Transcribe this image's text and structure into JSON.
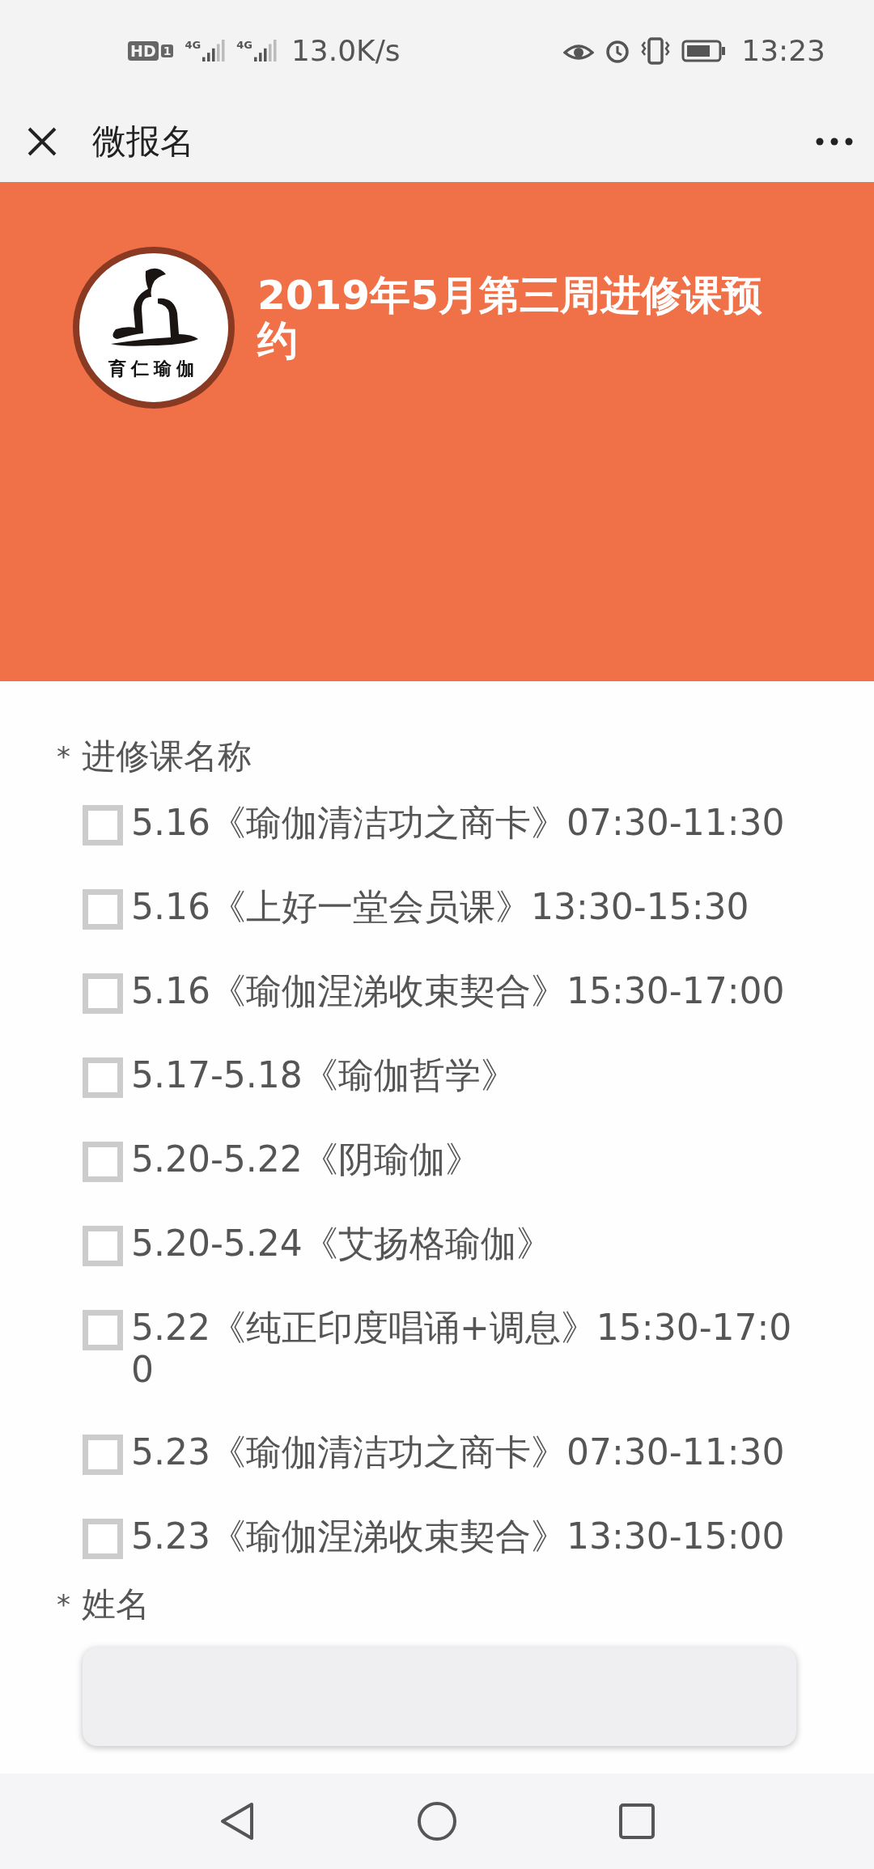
{
  "status_bar": {
    "hd_badge": "HD",
    "sim_slot": "1",
    "signals": [
      {
        "label": "4G"
      },
      {
        "label": "4G"
      }
    ],
    "speed": "13.0K/s",
    "time": "13:23"
  },
  "title_bar": {
    "title": "微报名"
  },
  "banner": {
    "logo_text": "育仁瑜伽",
    "title": "2019年5月第三周进修课预约"
  },
  "form": {
    "fields": [
      {
        "kind": "checkboxes",
        "label": "进修课名称",
        "mark": "*",
        "options": [
          {
            "text": "5.16《瑜伽清洁功之商卡》07:30-11:30",
            "checked": false
          },
          {
            "text": "5.16《上好一堂会员课》13:30-15:30",
            "checked": false
          },
          {
            "text": "5.16《瑜伽涅涕收束契合》15:30-17:00",
            "checked": false
          },
          {
            "text": "5.17-5.18《瑜伽哲学》",
            "checked": false
          },
          {
            "text": "5.20-5.22《阴瑜伽》",
            "checked": false
          },
          {
            "text": "5.20-5.24《艾扬格瑜伽》",
            "checked": false
          },
          {
            "text": "5.22《纯正印度唱诵+调息》15:30-17:00",
            "checked": false
          },
          {
            "text": "5.23《瑜伽清洁功之商卡》07:30-11:30",
            "checked": false
          },
          {
            "text": "5.23《瑜伽涅涕收束契合》13:30-15:00",
            "checked": false
          }
        ]
      },
      {
        "kind": "text",
        "label": "姓名",
        "mark": "*"
      }
    ]
  }
}
